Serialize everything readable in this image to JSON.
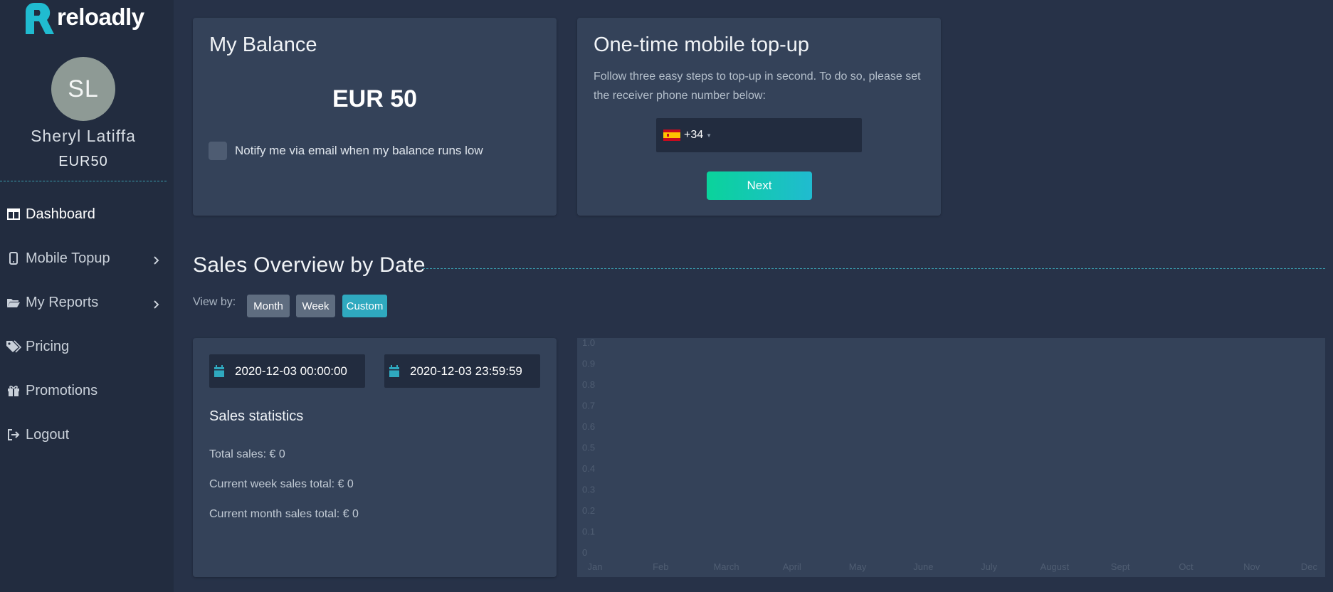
{
  "brand": {
    "name": "reloadly",
    "accent": "#20bbd0"
  },
  "user": {
    "initials": "SL",
    "name": "Sheryl Latiffa",
    "balance": "EUR50"
  },
  "nav": [
    {
      "label": "Dashboard",
      "icon": "dashboard-icon",
      "active": true
    },
    {
      "label": "Mobile Topup",
      "icon": "mobile-icon",
      "has_children": true
    },
    {
      "label": "My Reports",
      "icon": "folder-icon",
      "has_children": true
    },
    {
      "label": "Pricing",
      "icon": "tags-icon"
    },
    {
      "label": "Promotions",
      "icon": "gift-icon"
    },
    {
      "label": "Logout",
      "icon": "logout-icon"
    }
  ],
  "balance_card": {
    "title": "My Balance",
    "amount": "EUR 50",
    "notify_label": "Notify me via email when my balance runs low",
    "notify_checked": false
  },
  "topup_card": {
    "title": "One-time mobile top-up",
    "description": "Follow three easy steps to top-up in second. To do so, please set the receiver phone number below:",
    "dial_code": "+34",
    "country_flag": "spain-flag-icon",
    "phone_value": "",
    "next_label": "Next"
  },
  "sales": {
    "title": "Sales Overview by Date",
    "view_by_label": "View by:",
    "view_options": [
      "Month",
      "Week",
      "Custom"
    ],
    "selected_view": "Custom",
    "date_from": "2020-12-03  00:00:00",
    "date_to": "2020-12-03  23:59:59",
    "stats_title": "Sales statistics",
    "stats": [
      "Total sales: € 0",
      "Current week sales total: € 0",
      "Current month sales total: € 0"
    ]
  },
  "chart_data": {
    "type": "line",
    "categories": [
      "Jan",
      "Feb",
      "March",
      "April",
      "May",
      "June",
      "July",
      "August",
      "Sept",
      "Oct",
      "Nov",
      "Dec"
    ],
    "y_ticks": [
      "1.0",
      "0.9",
      "0.8",
      "0.7",
      "0.6",
      "0.5",
      "0.4",
      "0.3",
      "0.2",
      "0.1",
      "0"
    ],
    "ylim": [
      0,
      1
    ],
    "series": [],
    "grid": false
  }
}
